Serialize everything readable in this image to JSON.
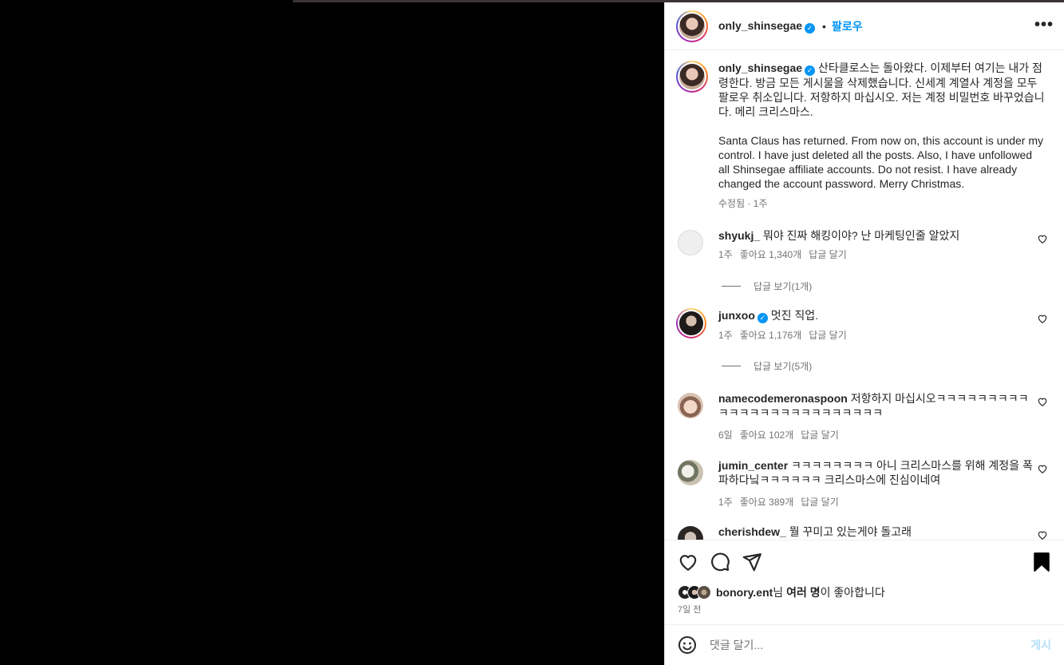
{
  "post": {
    "username": "only_shinsegae",
    "follow_label": "팔로우",
    "more_label": "•••"
  },
  "caption": {
    "username": "only_shinsegae",
    "text_ko": "산타클로스는 돌아왔다. 이제부터 여기는 내가 점령한다. 방금 모든 게시물을 삭제했습니다. 신세계 계열사 계정을 모두 팔로우 취소입니다. 저항하지 마십시오. 저는 계정 비밀번호 바꾸었습니다. 메리 크리스마스.",
    "text_en": "Santa Claus has returned. From now on, this account is under my control. I have just deleted all the posts. Also, I have unfollowed all Shinsegae affiliate accounts. Do not resist. I have already changed the account password. Merry Christmas.",
    "meta": "수정됨 · 1주"
  },
  "comments": [
    {
      "user": "shyukj_",
      "text": "뭐야 진짜 해킹이야? 난 마케팅인줄 알았지",
      "time": "1주",
      "likes": "좋아요 1,340개",
      "reply": "답글 달기",
      "view_replies": "답글 보기(1개)"
    },
    {
      "user": "junxoo",
      "text": "멋진 직업.",
      "time": "1주",
      "likes": "좋아요 1,176개",
      "reply": "답글 달기",
      "view_replies": "답글 보기(5개)"
    },
    {
      "user": "namecodemeronaspoon",
      "text": "저항하지 마십시오ㅋㅋㅋㅋㅋㅋㅋㅋㅋㅋㅋㅋㅋㅋㅋㅋㅋㅋㅋㅋㅋㅋㅋㅋㅋ",
      "time": "6일",
      "likes": "좋아요 102개",
      "reply": "답글 달기"
    },
    {
      "user": "jumin_center",
      "text": "ㅋㅋㅋㅋㅋㅋㅋㅋ 아니 크리스마스를 위해 계정을 폭파하다닠ㅋㅋㅋㅋㅋㅋ 크리스마스에 진심이네여",
      "time": "1주",
      "likes": "좋아요 389개",
      "reply": "답글 달기"
    },
    {
      "user": "cherishdew_",
      "text": "뭘 꾸미고 있는게야 돌고래"
    }
  ],
  "likes": {
    "user": "bonory.ent",
    "suffix1": "님 ",
    "others": "여러 명",
    "suffix2": "이 좋아합니다"
  },
  "posted_ago": "7일 전",
  "comment_box": {
    "placeholder": "댓글 달기...",
    "post_label": "게시"
  },
  "colors": {
    "accent": "#0095f6",
    "post_disabled": "#b2dffc",
    "muted": "#737373"
  }
}
